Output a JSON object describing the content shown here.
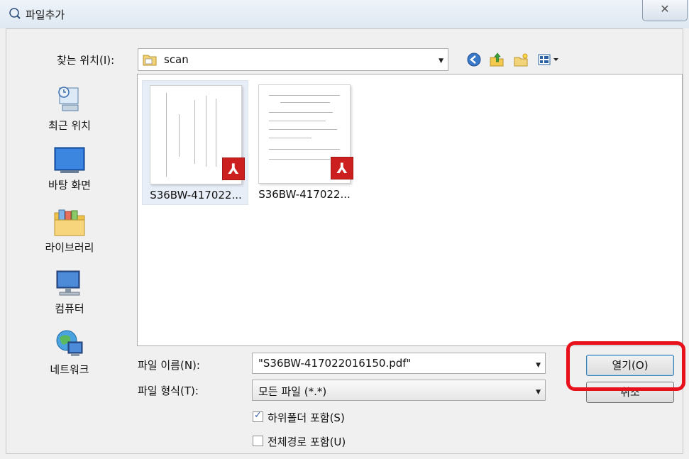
{
  "window": {
    "title": "파일추가",
    "close_glyph": "✕"
  },
  "lookin": {
    "label": "찾는 위치(I):",
    "value": "scan"
  },
  "toolbar_icons": [
    "back-icon",
    "up-folder-icon",
    "new-folder-icon",
    "view-menu-icon"
  ],
  "places": [
    {
      "label": "최근 위치",
      "icon": "recent-places-icon"
    },
    {
      "label": "바탕 화면",
      "icon": "desktop-icon"
    },
    {
      "label": "라이브러리",
      "icon": "libraries-icon"
    },
    {
      "label": "컴퓨터",
      "icon": "computer-icon"
    },
    {
      "label": "네트워크",
      "icon": "network-icon"
    }
  ],
  "files": [
    {
      "name": "S36BW-417022...",
      "type": "pdf",
      "selected": true
    },
    {
      "name": "S36BW-417022...",
      "type": "pdf",
      "selected": false
    }
  ],
  "filename": {
    "label": "파일 이름(N):",
    "value": "\"S36BW-417022016150.pdf\""
  },
  "filetype": {
    "label": "파일 형식(T):",
    "value": "모든 파일 (*.*)"
  },
  "options": [
    {
      "label": "하위폴더 포함(S)",
      "checked": true
    },
    {
      "label": "전체경로 포함(U)",
      "checked": false
    }
  ],
  "buttons": {
    "open": "열기(O)",
    "cancel": "취소"
  },
  "colors": {
    "highlight": "#e8101a",
    "pdf_red": "#cc1f1f"
  }
}
